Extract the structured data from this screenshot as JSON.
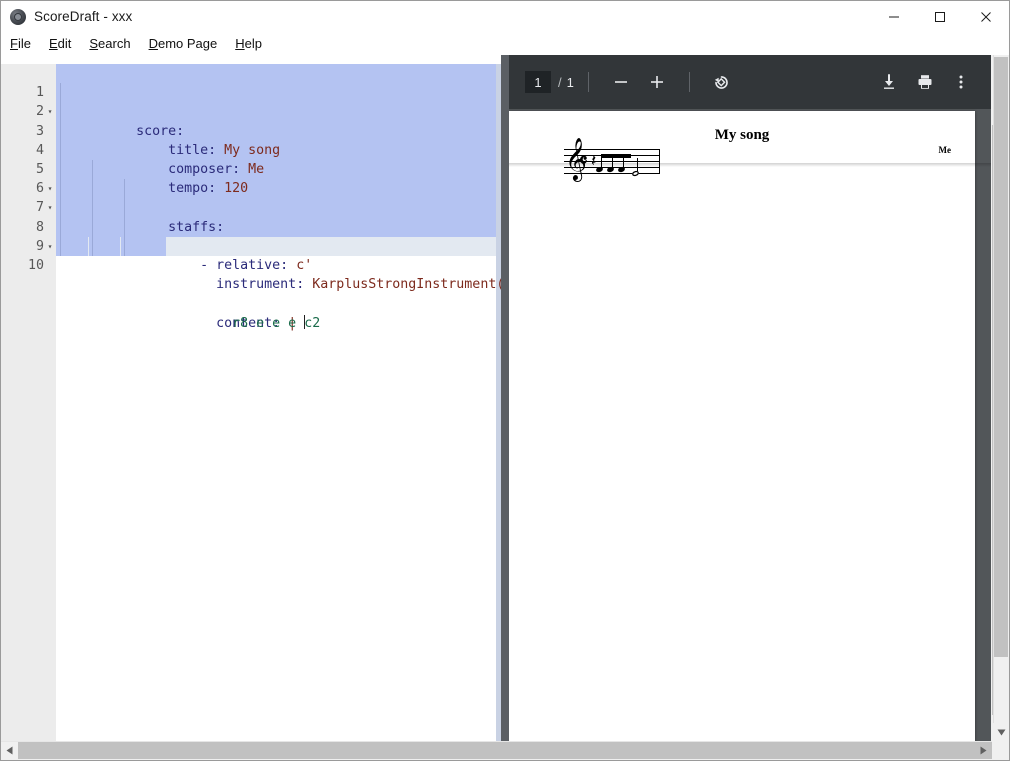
{
  "window": {
    "title": "ScoreDraft - xxx",
    "app_icon": "scoredraft-logo-icon",
    "controls": {
      "minimize": "minimize-button",
      "maximize": "maximize-button",
      "close": "close-button"
    }
  },
  "menubar": {
    "items": [
      {
        "label": "File",
        "accel": "F",
        "rest": "ile"
      },
      {
        "label": "Edit",
        "accel": "E",
        "rest": "dit"
      },
      {
        "label": "Search",
        "accel": "S",
        "rest": "earch"
      },
      {
        "label": "Demo Page",
        "accel": "D",
        "rest": "emo Page"
      },
      {
        "label": "Help",
        "accel": "H",
        "rest": "elp"
      }
    ]
  },
  "editor": {
    "language": "yaml",
    "selection_active": true,
    "current_line": 10,
    "lines": [
      {
        "num": "1",
        "foldable": true,
        "text": "score:"
      },
      {
        "num": "2",
        "foldable": false,
        "text": "    title: My song"
      },
      {
        "num": "3",
        "foldable": false,
        "text": "    composer: Me"
      },
      {
        "num": "4",
        "foldable": false,
        "text": "    tempo: 120"
      },
      {
        "num": "5",
        "foldable": true,
        "text": "    staffs:"
      },
      {
        "num": "6",
        "foldable": true,
        "text": "        - relative: c'"
      },
      {
        "num": "7",
        "foldable": false,
        "text": "          instrument: KarplusStrongInstrument()"
      },
      {
        "num": "8",
        "foldable": true,
        "text": "          content: |"
      },
      {
        "num": "9",
        "foldable": false,
        "text": "            r8 e e e c2"
      },
      {
        "num": "10",
        "foldable": false,
        "text": ""
      }
    ],
    "colors": {
      "selection": "#b4c3f2",
      "current_line": "#e3e9f1",
      "gutter_bg": "#ececec",
      "key": "#2b2b7a",
      "value": "#7d2a1d",
      "string": "#1a6b4a"
    }
  },
  "pdf_viewer": {
    "toolbar": {
      "page_number": "1",
      "page_separator": "/",
      "page_total": "1",
      "zoom_out_label": "−",
      "zoom_in_label": "+",
      "rotate_icon": "rotate-counterclockwise-icon",
      "download_icon": "download-icon",
      "print_icon": "print-icon",
      "more_icon": "more-vertical-icon"
    },
    "background_color": "#525659",
    "toolbar_color": "#323639",
    "page": {
      "title": "My song",
      "composer": "Me",
      "score": {
        "clef": "treble-clef",
        "clef_glyph": "𝄞",
        "time_signature": "common-time",
        "time_glyph": "𝄴",
        "rest": "eighth-rest",
        "rest_glyph": "𝄽",
        "notes": "r8 e e e c2"
      }
    }
  },
  "scrollbars": {
    "editor_vertical": "editor-vertical-scrollbar",
    "pdf_vertical": "pdf-vertical-scrollbar",
    "window_vertical": "window-vertical-scrollbar",
    "window_horizontal": "window-horizontal-scrollbar"
  }
}
